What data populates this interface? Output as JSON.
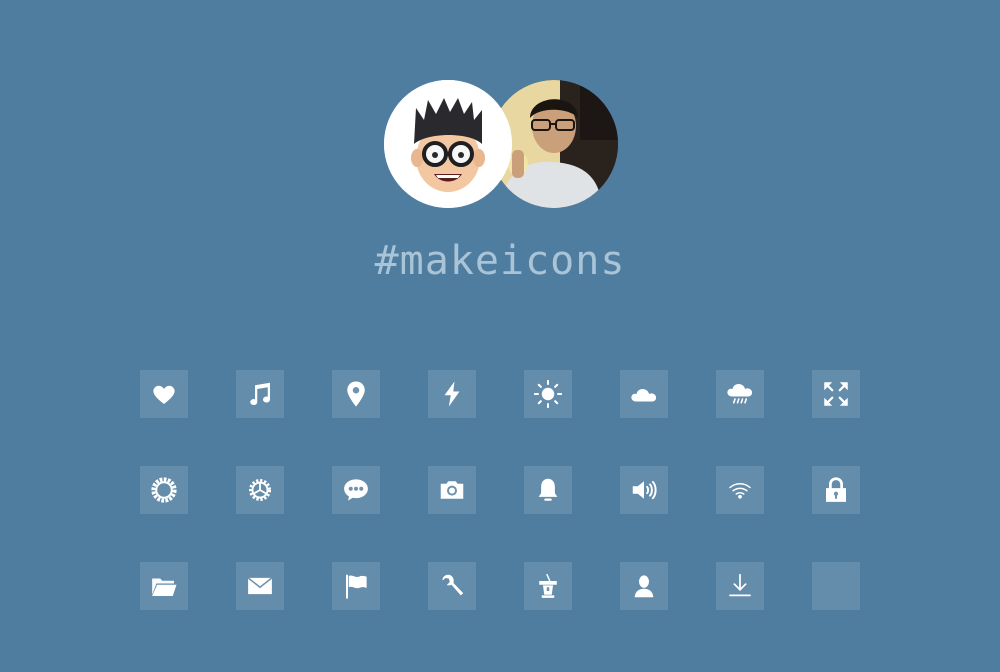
{
  "header": {
    "hashtag": "#makeicons",
    "avatars": [
      {
        "name": "memoji-avatar",
        "kind": "illustrated"
      },
      {
        "name": "photo-avatar",
        "kind": "photo"
      }
    ]
  },
  "icons": [
    [
      "heart-icon",
      "music-note-icon",
      "map-pin-icon",
      "lightning-bolt-icon",
      "sun-icon",
      "cloud-icon",
      "rain-cloud-icon",
      "expand-arrows-icon"
    ],
    [
      "settings-ring-icon",
      "gear-icon",
      "chat-bubble-icon",
      "camera-icon",
      "bell-icon",
      "speaker-volume-icon",
      "wifi-icon",
      "lock-icon"
    ],
    [
      "folder-icon",
      "mail-envelope-icon",
      "flag-icon",
      "wrench-icon",
      "podium-icon",
      "user-icon",
      "download-icon",
      "empty-slot"
    ]
  ],
  "colors": {
    "background": "#4f7da0",
    "tile": "rgba(255,255,255,0.12)",
    "hashtag": "#a9c3d7",
    "icon": "#ffffff"
  }
}
